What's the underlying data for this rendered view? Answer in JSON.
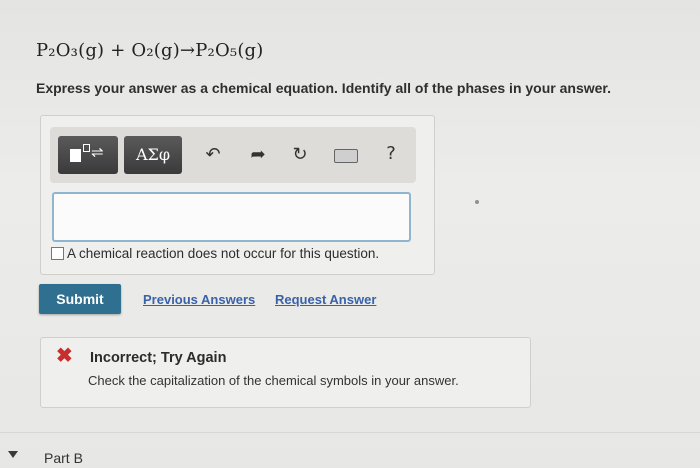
{
  "question": {
    "equation": "P₂O₃(g) + O₂(g)→P₂O₅(g)",
    "instructions": "Express your answer as a chemical equation. Identify all of the phases in your answer."
  },
  "toolbar": {
    "template_icon": "template-icon",
    "greek_label": "ΑΣφ",
    "undo_icon": "↶",
    "redo_icon": "➦",
    "reset_icon": "↻",
    "keyboard_icon": "keyboard-icon",
    "help_label": "?"
  },
  "answer": {
    "value": "",
    "no_reaction_label": "A chemical reaction does not occur for this question."
  },
  "actions": {
    "submit_label": "Submit",
    "previous_answers_label": "Previous Answers",
    "request_answer_label": "Request Answer"
  },
  "feedback": {
    "icon": "✖",
    "title": "Incorrect; Try Again",
    "message": "Check the capitalization of the chemical symbols in your answer."
  },
  "part_b": {
    "label": "Part B"
  },
  "colors": {
    "submit_bg": "#2f6f8f",
    "link": "#3a62a8",
    "error": "#c92e2e",
    "input_border": "#8fb5cf"
  }
}
